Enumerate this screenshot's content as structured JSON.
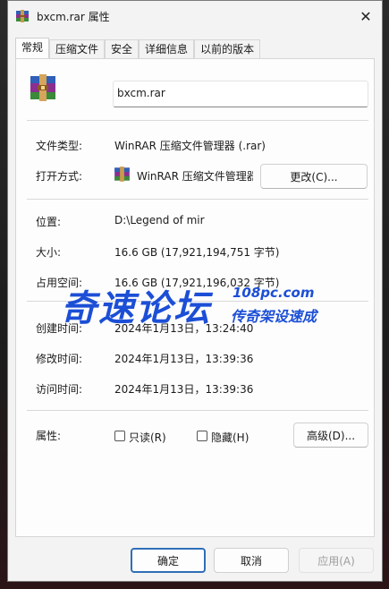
{
  "window": {
    "title": "bxcm.rar 属性"
  },
  "tabs": [
    {
      "label": "常规"
    },
    {
      "label": "压缩文件"
    },
    {
      "label": "安全"
    },
    {
      "label": "详细信息"
    },
    {
      "label": "以前的版本"
    }
  ],
  "general": {
    "file_name": "bxcm.rar",
    "type_label": "文件类型:",
    "type_value": "WinRAR 压缩文件管理器 (.rar)",
    "open_label": "打开方式:",
    "open_value": "WinRAR 压缩文件管理器",
    "change_button": "更改(C)...",
    "location_label": "位置:",
    "location_value": "D:\\Legend of mir",
    "size_label": "大小:",
    "size_value": "16.6 GB (17,921,194,751 字节)",
    "disk_size_label": "占用空间:",
    "disk_size_value": "16.6 GB (17,921,196,032 字节)",
    "created_label": "创建时间:",
    "created_value": "2024年1月13日，13:24:40",
    "modified_label": "修改时间:",
    "modified_value": "2024年1月13日，13:39:36",
    "accessed_label": "访问时间:",
    "accessed_value": "2024年1月13日，13:39:36",
    "attributes_label": "属性:",
    "readonly_label": "只读(R)",
    "readonly_checked": false,
    "hidden_label": "隐藏(H)",
    "hidden_checked": false,
    "advanced_button": "高级(D)..."
  },
  "footer": {
    "ok": "确定",
    "cancel": "取消",
    "apply": "应用(A)"
  },
  "watermark": {
    "main": "奇速论坛",
    "site": "108pc.com",
    "sub": "传奇架设速成"
  },
  "colors": {
    "accent": "#2f6fb7",
    "watermark": "#1c4fd6"
  },
  "icons": {
    "title": "winrar-archive-icon",
    "file": "winrar-archive-icon",
    "open_with": "winrar-app-icon",
    "close": "close-icon"
  }
}
